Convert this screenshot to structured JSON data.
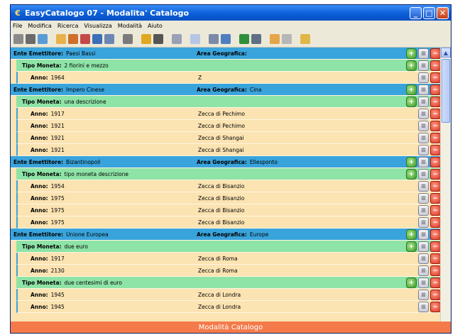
{
  "window": {
    "title": "EasyCatalogo 07 - Modalita' Catalogo"
  },
  "menu": [
    "File",
    "Modifica",
    "Ricerca",
    "Visualizza",
    "Modalità",
    "Aiuto"
  ],
  "labels": {
    "ente": "Ente Emettitore:",
    "area": "Area Geografica:",
    "tipo": "Tipo Moneta:",
    "anno": "Anno:"
  },
  "rows": [
    {
      "kind": "ente",
      "name": "Paesi Bassi",
      "area": ""
    },
    {
      "kind": "tipo",
      "name": "2 fiorini e mezzo"
    },
    {
      "kind": "anno",
      "year": "1964",
      "zecca": "Z"
    },
    {
      "kind": "ente",
      "name": "Impero Cinese",
      "area": "Cina"
    },
    {
      "kind": "tipo",
      "name": "una descrizione"
    },
    {
      "kind": "anno",
      "year": "1917",
      "zecca": "Zecca di Pechimo"
    },
    {
      "kind": "anno",
      "year": "1921",
      "zecca": "Zecca di Pechimo"
    },
    {
      "kind": "anno",
      "year": "1921",
      "zecca": "Zecca di Shangai"
    },
    {
      "kind": "anno",
      "year": "1921",
      "zecca": "Zecca di Shangai"
    },
    {
      "kind": "ente",
      "name": "Bizantinopoli",
      "area": "Ellesponto"
    },
    {
      "kind": "tipo",
      "name": "tipo moneta descrizione"
    },
    {
      "kind": "anno",
      "year": "1954",
      "zecca": "Zecca di Bisanzio"
    },
    {
      "kind": "anno",
      "year": "1975",
      "zecca": "Zecca di Bisanzio"
    },
    {
      "kind": "anno",
      "year": "1975",
      "zecca": "Zecca di Bisanzio"
    },
    {
      "kind": "anno",
      "year": "1975",
      "zecca": "Zecca di Bisanzio"
    },
    {
      "kind": "ente",
      "name": "Unione Europea",
      "area": "Europe"
    },
    {
      "kind": "tipo",
      "name": "due euro"
    },
    {
      "kind": "anno",
      "year": "1917",
      "zecca": "Zecca di Roma"
    },
    {
      "kind": "anno",
      "year": "2130",
      "zecca": "Zecca di Roma"
    },
    {
      "kind": "tipo",
      "name": "due centesimi di euro"
    },
    {
      "kind": "anno",
      "year": "1945",
      "zecca": "Zecca di Londra"
    },
    {
      "kind": "anno",
      "year": "1945",
      "zecca": "Zecca di Londra"
    }
  ],
  "status": "Modalità Catalogo",
  "colors": {
    "ente": "#39a4dc",
    "tipo": "#8ee3a6",
    "anno": "#fbe3b2",
    "status": "#f47a4a",
    "titlebar": "#0b5fd8"
  }
}
